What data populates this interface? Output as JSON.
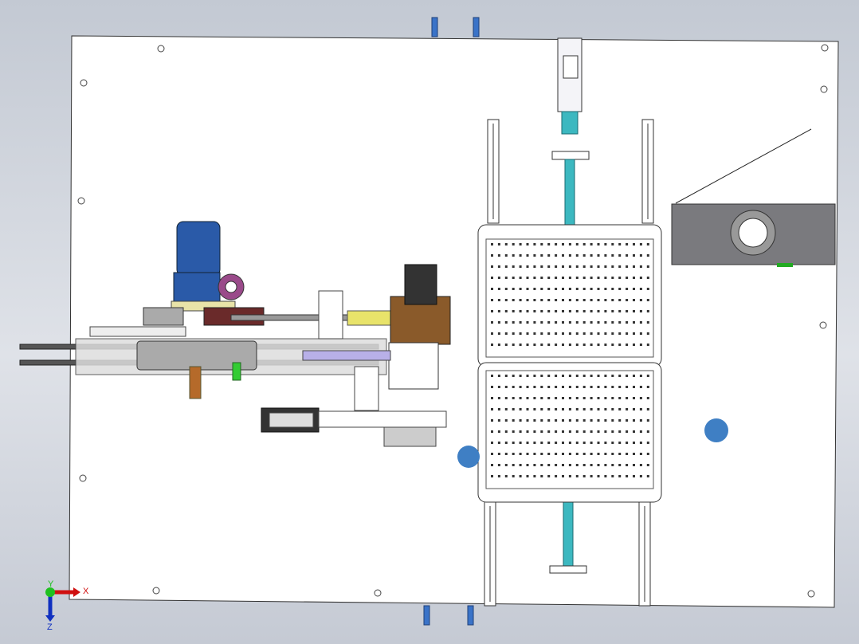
{
  "viewport": {
    "triad": {
      "x_label": "X",
      "y_label": "Y",
      "z_label": "Z"
    },
    "colors": {
      "plate": "#ffffff",
      "motor": "#2a5aa8",
      "screw": "#3cb8c0",
      "marker": "#3f7fc4",
      "housing": "#6e6e72",
      "bracket": "#e8e36a",
      "axis_x": "#d01010",
      "axis_y": "#20c020",
      "axis_z": "#1030c0"
    },
    "tray_grid": {
      "cols": 23,
      "rows": 10
    }
  }
}
